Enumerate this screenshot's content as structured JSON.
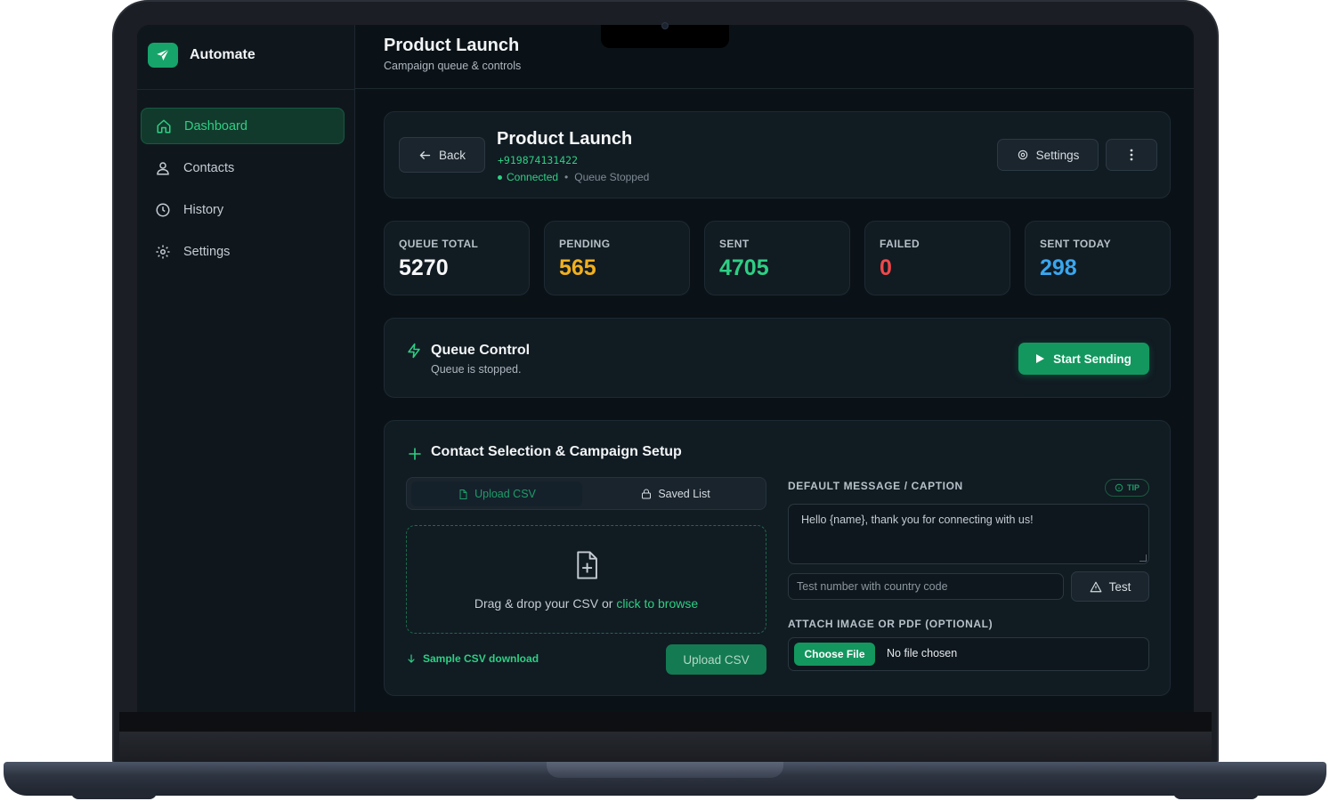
{
  "app": {
    "name": "Automate"
  },
  "sidebar": {
    "items": [
      {
        "label": "Dashboard",
        "icon": "home-icon",
        "active": true
      },
      {
        "label": "Contacts",
        "icon": "user-icon",
        "active": false
      },
      {
        "label": "History",
        "icon": "clock-icon",
        "active": false
      },
      {
        "label": "Settings",
        "icon": "gear-icon",
        "active": false
      }
    ]
  },
  "header": {
    "title": "Product Launch",
    "subtitle": "Campaign queue & controls"
  },
  "campaign": {
    "back_label": "Back",
    "title": "Product Launch",
    "phone": "+919874131422",
    "connection_status": "Connected",
    "queue_status": "Queue Stopped",
    "settings_label": "Settings"
  },
  "stats": [
    {
      "label": "QUEUE TOTAL",
      "value": "5270",
      "color": "#f5f7f8"
    },
    {
      "label": "PENDING",
      "value": "565",
      "color": "#f2b01e"
    },
    {
      "label": "SENT",
      "value": "4705",
      "color": "#2ecf84"
    },
    {
      "label": "FAILED",
      "value": "0",
      "color": "#f0484a"
    },
    {
      "label": "SENT TODAY",
      "value": "298",
      "color": "#3aa6ee"
    }
  ],
  "queue_control": {
    "title": "Queue Control",
    "status": "Queue is stopped.",
    "start_label": "Start Sending"
  },
  "setup": {
    "title": "Contact Selection & Campaign Setup",
    "tabs": [
      {
        "label": "Upload CSV",
        "active": true
      },
      {
        "label": "Saved List",
        "active": false
      }
    ],
    "dropzone_text": "Drag & drop your CSV or ",
    "dropzone_link": "click to browse",
    "sample_link": "Sample CSV download",
    "upload_label": "Upload CSV",
    "message_label": "DEFAULT MESSAGE / CAPTION",
    "tip_label": "TIP",
    "message_value": "Hello {name}, thank you for connecting with us!",
    "test_placeholder": "Test number with country code",
    "test_label": "Test",
    "attach_label": "ATTACH IMAGE OR PDF (OPTIONAL)",
    "choose_file_label": "Choose File",
    "no_file_label": "No file chosen"
  },
  "colors": {
    "accent": "#13975f",
    "background": "#0b1217",
    "card": "#111b22"
  }
}
